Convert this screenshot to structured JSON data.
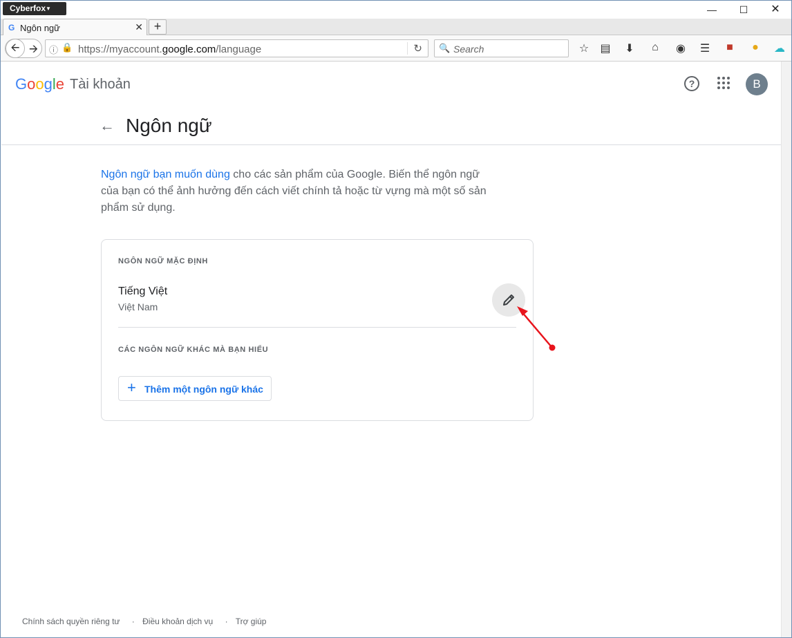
{
  "browser": {
    "menu_label": "Cyberfox",
    "tab_title": "Ngôn ngữ",
    "tab_favicon": "G",
    "url_prefix": "https://myaccount.",
    "url_domain": "google.com",
    "url_path": "/language",
    "search_placeholder": "Search"
  },
  "header": {
    "logo_letters": [
      "G",
      "o",
      "o",
      "g",
      "l",
      "e"
    ],
    "logo_colors": [
      "#4285f4",
      "#ea4335",
      "#fbbc05",
      "#4285f4",
      "#34a853",
      "#ea4335"
    ],
    "account_label": "Tài khoản",
    "avatar_letter": "B",
    "help_icon": "?"
  },
  "page": {
    "title": "Ngôn ngữ",
    "intro_link": "Ngôn ngữ bạn muốn dùng",
    "intro_text": " cho các sản phẩm của Google. Biến thể ngôn ngữ của bạn có thể ảnh hưởng đến cách viết chính tả hoặc từ vựng mà một số sản phẩm sử dụng."
  },
  "card": {
    "default_header": "NGÔN NGỮ MẶC ĐỊNH",
    "default_language": "Tiếng Việt",
    "default_region": "Việt Nam",
    "other_header": "CÁC NGÔN NGỮ KHÁC MÀ BẠN HIỂU",
    "add_button": "Thêm một ngôn ngữ khác"
  },
  "footer": {
    "privacy": "Chính sách quyền riêng tư",
    "terms": "Điều khoản dịch vụ",
    "help": "Trợ giúp"
  },
  "annotation_color": "#e8141c"
}
